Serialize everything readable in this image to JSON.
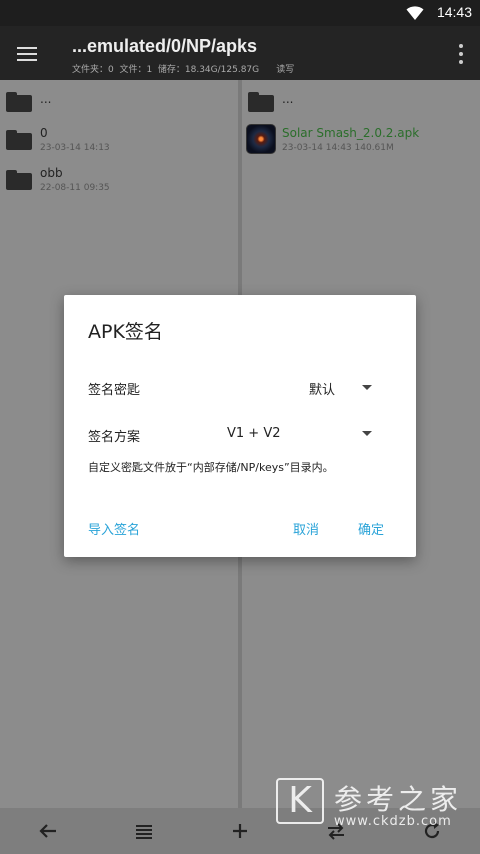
{
  "status_bar": {
    "time": "14:43",
    "wifi_icon": "wifi-icon"
  },
  "app_bar": {
    "title": "...emulated/0/NP/apks",
    "subtitle": "文件夹：0  文件：1  储存：18.34G/125.87G      读写"
  },
  "left_pane": {
    "items": [
      {
        "name": "...",
        "meta": ""
      },
      {
        "name": "0",
        "meta": "23-03-14 14:13"
      },
      {
        "name": "obb",
        "meta": "22-08-11 09:35"
      }
    ]
  },
  "right_pane": {
    "items": [
      {
        "name": "...",
        "meta": ""
      },
      {
        "name": "Solar Smash_2.0.2.apk",
        "meta": "23-03-14 14:43  140.61M"
      }
    ]
  },
  "dialog": {
    "title": "APK签名",
    "key_label": "签名密匙",
    "key_value": "默认",
    "scheme_label": "签名方案",
    "scheme_value": "V1 + V2",
    "note": "自定义密匙文件放于“内部存储/NP/keys”目录内。",
    "import_button": "导入签名",
    "cancel_button": "取消",
    "ok_button": "确定"
  },
  "watermark": {
    "logo_letter": "K",
    "text": "参考之家",
    "url": "www.ckdzb.com"
  },
  "colors": {
    "accent": "#2aa3d8",
    "apk_name": "#2b6e2b",
    "app_bar": "#242424"
  }
}
